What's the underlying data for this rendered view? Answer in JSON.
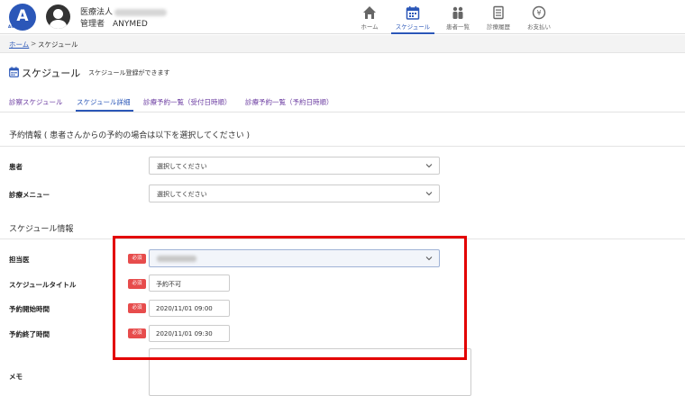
{
  "header": {
    "logo_text": "A",
    "logo_sub": "ANYMED",
    "org_label": "医療法人",
    "manager_label": "管理者　ANYMED",
    "nav": [
      {
        "label": "ホーム",
        "icon": "home-icon"
      },
      {
        "label": "スケジュール",
        "icon": "calendar-icon",
        "active": true
      },
      {
        "label": "患者一覧",
        "icon": "users-icon"
      },
      {
        "label": "診療履歴",
        "icon": "document-icon"
      },
      {
        "label": "お支払い",
        "icon": "yen-icon"
      }
    ]
  },
  "breadcrumb": {
    "home": "ホーム",
    "separator": ">",
    "current": "スケジュール"
  },
  "page": {
    "title": "スケジュール",
    "subtitle": "スケジュール登録ができます"
  },
  "tabs": [
    {
      "label": "診察スケジュール"
    },
    {
      "label": "スケジュール詳細",
      "active": true
    },
    {
      "label": "診療予約一覧（受付日時順）"
    },
    {
      "label": "診療予約一覧（予約日時順）"
    }
  ],
  "reservation": {
    "section_title": "予約情報 ( 患者さんからの予約の場合は以下を選択してください )",
    "patient_label": "患者",
    "patient_value": "選択してください",
    "menu_label": "診療メニュー",
    "menu_value": "選択してください"
  },
  "schedule": {
    "section_title": "スケジュール情報",
    "required_badge": "必須",
    "doctor_label": "担当医",
    "title_label": "スケジュールタイトル",
    "title_value": "予約不可",
    "start_label": "予約開始時間",
    "start_value": "2020/11/01 09:00",
    "end_label": "予約終了時間",
    "end_value": "2020/11/01 09:30",
    "memo_label": "メモ"
  },
  "colors": {
    "accent": "#2b57b8",
    "required": "#e74c4c",
    "highlight_frame": "#e30000",
    "tab_link": "#6a3aa0"
  }
}
